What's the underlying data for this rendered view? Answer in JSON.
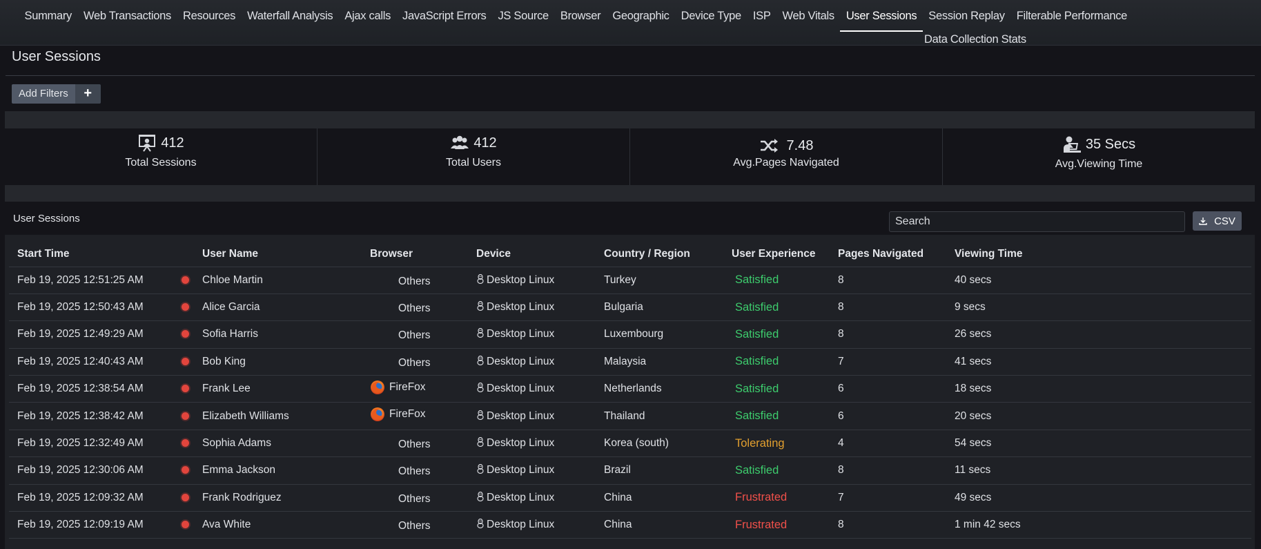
{
  "nav": {
    "tabs": [
      {
        "label": "Summary"
      },
      {
        "label": "Web Transactions"
      },
      {
        "label": "Resources"
      },
      {
        "label": "Waterfall Analysis"
      },
      {
        "label": "Ajax calls"
      },
      {
        "label": "JavaScript Errors"
      },
      {
        "label": "JS Source"
      },
      {
        "label": "Browser"
      },
      {
        "label": "Geographic"
      },
      {
        "label": "Device Type"
      },
      {
        "label": "ISP"
      },
      {
        "label": "Web Vitals"
      },
      {
        "label": "User Sessions",
        "active": true
      },
      {
        "label": "Session Replay"
      },
      {
        "label": "Filterable Performance"
      }
    ],
    "second_row_tab": "Data Collection Stats"
  },
  "page": {
    "title": "User Sessions",
    "add_filters_label": "Add Filters",
    "add_filters_plus": "+"
  },
  "stats": [
    {
      "value": "412",
      "caption": "Total Sessions",
      "icon": "presentation-icon"
    },
    {
      "value": "412",
      "caption": "Total Users",
      "icon": "users-icon"
    },
    {
      "value": "7.48",
      "caption": "Avg.Pages Navigated",
      "icon": "shuffle-icon"
    },
    {
      "value": "35 Secs",
      "caption": "Avg.Viewing Time",
      "icon": "user-laptop-icon"
    }
  ],
  "table": {
    "title": "User Sessions",
    "search_placeholder": "Search",
    "csv_label": "CSV",
    "columns": [
      "Start Time",
      "User Name",
      "Browser",
      "Device",
      "Country / Region",
      "User Experience",
      "Pages Navigated",
      "Viewing Time"
    ],
    "rows": [
      {
        "start": "Feb 19, 2025 12:51:25 AM",
        "user": "Chloe Martin",
        "browser": "Others",
        "device": "Desktop Linux",
        "country": "Turkey",
        "ux": "Satisfied",
        "pages": "8",
        "time": "40 secs"
      },
      {
        "start": "Feb 19, 2025 12:50:43 AM",
        "user": "Alice Garcia",
        "browser": "Others",
        "device": "Desktop Linux",
        "country": "Bulgaria",
        "ux": "Satisfied",
        "pages": "8",
        "time": "9 secs"
      },
      {
        "start": "Feb 19, 2025 12:49:29 AM",
        "user": "Sofia Harris",
        "browser": "Others",
        "device": "Desktop Linux",
        "country": "Luxembourg",
        "ux": "Satisfied",
        "pages": "8",
        "time": "26 secs"
      },
      {
        "start": "Feb 19, 2025 12:40:43 AM",
        "user": "Bob King",
        "browser": "Others",
        "device": "Desktop Linux",
        "country": "Malaysia",
        "ux": "Satisfied",
        "pages": "7",
        "time": "41 secs"
      },
      {
        "start": "Feb 19, 2025 12:38:54 AM",
        "user": "Frank Lee",
        "browser": "FireFox",
        "device": "Desktop Linux",
        "country": "Netherlands",
        "ux": "Satisfied",
        "pages": "6",
        "time": "18 secs"
      },
      {
        "start": "Feb 19, 2025 12:38:42 AM",
        "user": "Elizabeth Williams",
        "browser": "FireFox",
        "device": "Desktop Linux",
        "country": "Thailand",
        "ux": "Satisfied",
        "pages": "6",
        "time": "20 secs"
      },
      {
        "start": "Feb 19, 2025 12:32:49 AM",
        "user": "Sophia Adams",
        "browser": "Others",
        "device": "Desktop Linux",
        "country": "Korea (south)",
        "ux": "Tolerating",
        "pages": "4",
        "time": "54 secs"
      },
      {
        "start": "Feb 19, 2025 12:30:06 AM",
        "user": "Emma Jackson",
        "browser": "Others",
        "device": "Desktop Linux",
        "country": "Brazil",
        "ux": "Satisfied",
        "pages": "8",
        "time": "11 secs"
      },
      {
        "start": "Feb 19, 2025 12:09:32 AM",
        "user": "Frank Rodriguez",
        "browser": "Others",
        "device": "Desktop Linux",
        "country": "China",
        "ux": "Frustrated",
        "pages": "7",
        "time": "49 secs"
      },
      {
        "start": "Feb 19, 2025 12:09:19 AM",
        "user": "Ava White",
        "browser": "Others",
        "device": "Desktop Linux",
        "country": "China",
        "ux": "Frustrated",
        "pages": "8",
        "time": "1 min 42 secs"
      }
    ]
  },
  "colors": {
    "satisfied": "#3dcc6d",
    "tolerating": "#e3a02f",
    "frustrated": "#f0504a",
    "error_dot": "#e2453d"
  }
}
